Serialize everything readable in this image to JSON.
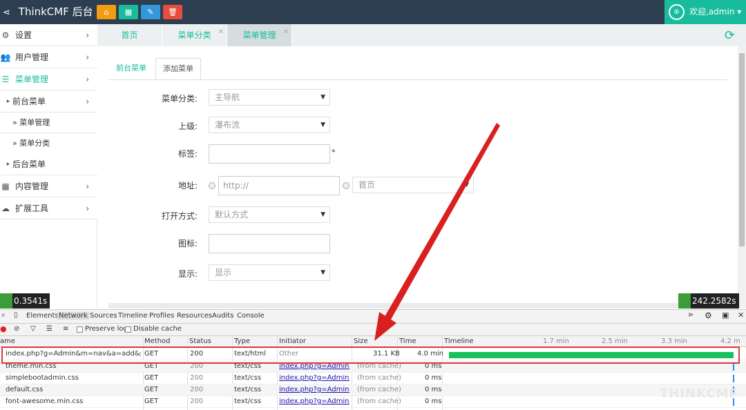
{
  "app": {
    "title": "ThinkCMF 后台",
    "welcome": "欢迎,admin",
    "colors": {
      "topbar": "#2c3e50",
      "accent": "#18bc9c",
      "btn_orange": "#f39c12",
      "btn_teal": "#1abc9c",
      "btn_blue": "#3498db",
      "btn_red": "#e74c3c",
      "highlight": "#d9363e"
    }
  },
  "quick_buttons": [
    {
      "icon": "home-icon",
      "glyph": "⌂"
    },
    {
      "icon": "grid-icon",
      "glyph": "▦"
    },
    {
      "icon": "pencil-icon",
      "glyph": "✎"
    },
    {
      "icon": "trash-icon",
      "glyph": "🗑"
    }
  ],
  "sidebar": {
    "items": [
      {
        "label": "设置",
        "icon": "gears-icon",
        "glyph": "⚙"
      },
      {
        "label": "用户管理",
        "icon": "users-icon",
        "glyph": "👥"
      },
      {
        "label": "菜单管理",
        "icon": "list-icon",
        "glyph": "☰"
      },
      {
        "label": "前台菜单",
        "icon": "caret-right-icon",
        "glyph": "▸"
      },
      {
        "label": "» 菜单管理"
      },
      {
        "label": "» 菜单分类"
      },
      {
        "label": "后台菜单",
        "icon": "caret-right-icon",
        "glyph": "▸"
      },
      {
        "label": "内容管理",
        "icon": "th-icon",
        "glyph": "▦"
      },
      {
        "label": "扩展工具",
        "icon": "cloud-icon",
        "glyph": "☁"
      }
    ]
  },
  "tabs": [
    {
      "label": "首页"
    },
    {
      "label": "菜单分类",
      "close": "✕"
    },
    {
      "label": "菜单管理",
      "close": "✕"
    }
  ],
  "content_tabs": [
    {
      "label": "前台菜单"
    },
    {
      "label": "添加菜单"
    }
  ],
  "form": {
    "category_label": "菜单分类:",
    "category_value": "主导航",
    "parent_label": "上级:",
    "parent_value": "瀑布流",
    "tag_label": "标签:",
    "required_mark": "*",
    "address_label": "地址:",
    "address_placeholder": "http://",
    "address_select": "首页",
    "open_label": "打开方式:",
    "open_value": "默认方式",
    "icon_label": "图标:",
    "display_label": "显示:",
    "display_value": "显示"
  },
  "timers": {
    "left": "0.3541s",
    "right": "242.2582s"
  },
  "devtools": {
    "tabs": [
      "Elements",
      "Network",
      "Sources",
      "Timeline",
      "Profiles",
      "Resources",
      "Audits",
      "Console"
    ],
    "preserve_log": "Preserve log",
    "disable_cache": "Disable cache",
    "headers": [
      "ame",
      "Method",
      "Status",
      "Type",
      "Initiator",
      "Size",
      "Time",
      "Timeline"
    ],
    "timeline_ticks": [
      "1.7 min",
      "2.5 min",
      "3.3 min",
      "4.2 m"
    ],
    "rows": [
      {
        "name": "index.php?g=Admin&m=nav&a=add&pare...",
        "method": "GET",
        "status": "200",
        "type": "text/html",
        "initiator": "Other",
        "size": "31.1 KB",
        "time": "4.0 min"
      },
      {
        "name": "theme.min.css",
        "method": "GET",
        "status": "200",
        "type": "text/css",
        "initiator": "index.php?g=Admin&...",
        "size": "(from cache)",
        "time": "0 ms"
      },
      {
        "name": "simplebootadmin.css",
        "method": "GET",
        "status": "200",
        "type": "text/css",
        "initiator": "index.php?g=Admin&...",
        "size": "(from cache)",
        "time": "0 ms"
      },
      {
        "name": "default.css",
        "method": "GET",
        "status": "200",
        "type": "text/css",
        "initiator": "index.php?g=Admin&...",
        "size": "(from cache)",
        "time": "0 ms"
      },
      {
        "name": "font-awesome.min.css",
        "method": "GET",
        "status": "200",
        "type": "text/css",
        "initiator": "index.php?g=Admin&...",
        "size": "(from cache)",
        "time": "0 ms"
      }
    ]
  },
  "watermark": "THINKCMF"
}
